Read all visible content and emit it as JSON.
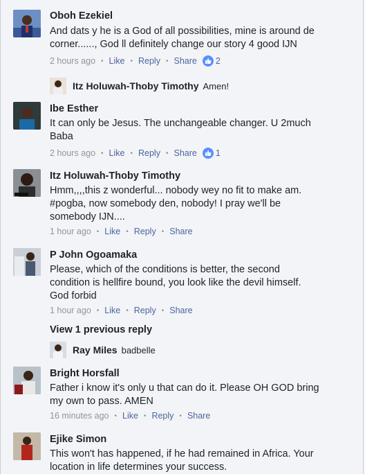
{
  "comments": [
    {
      "name": "Oboh Ezekiel",
      "text": "And dats y he is a God of all possibilities, mine is around de\ncorner......, God ll definitely change our story 4 good IJN",
      "time": "2 hours ago",
      "like": "Like",
      "reply": "Reply",
      "share": "Share",
      "likes": "2",
      "replies": [
        {
          "name": "Itz Holuwah-Thoby Timothy",
          "text": "Amen!"
        }
      ]
    },
    {
      "name": "Ibe Esther",
      "text": "It can only be Jesus. The unchangeable changer. U 2much\nBaba",
      "time": "2 hours ago",
      "like": "Like",
      "reply": "Reply",
      "share": "Share",
      "likes": "1"
    },
    {
      "name": "Itz Holuwah-Thoby Timothy",
      "text": "Hmm,,,,this z wonderful... nobody wey no fit to make am.\n#pogba, now somebody  den, nobody! I pray we'll be\nsomebody IJN....",
      "time": "1 hour ago",
      "like": "Like",
      "reply": "Reply",
      "share": "Share"
    },
    {
      "name": "P John Ogoamaka",
      "text": "Please, which of the conditions is better, the second\ncondition is hellfire bound, you look like the devil himself.\nGod forbid",
      "time": "1 hour ago",
      "like": "Like",
      "reply": "Reply",
      "share": "Share",
      "view_previous": "View 1 previous reply",
      "replies": [
        {
          "name": "Ray Miles",
          "text": "badbelle"
        }
      ]
    },
    {
      "name": "Bright Horsfall",
      "text": "Father i know it's only u that can do it. Please OH GOD bring\nmy own to pass. AMEN",
      "time": "16 minutes ago",
      "like": "Like",
      "reply": "Reply",
      "share": "Share"
    },
    {
      "name": "Ejike Simon",
      "text": "This won't has happened, if he had remained in Africa. Your\nlocation in life determines your success."
    }
  ],
  "icons": {
    "like_badge": "thumbs-up-icon"
  },
  "colors": {
    "link": "#4b64a0",
    "meta": "#90949c",
    "like_badge": "#5890ff"
  }
}
